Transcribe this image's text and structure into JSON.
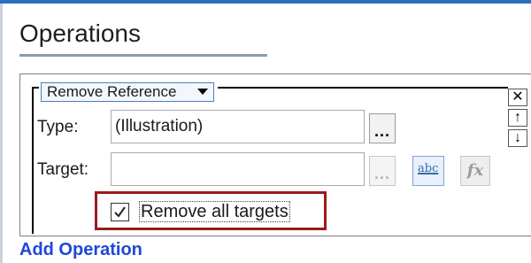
{
  "operations": {
    "title": "Operations",
    "operation_dropdown": {
      "value": "Remove Reference"
    },
    "type": {
      "label": "Type:",
      "value": "(Illustration)",
      "browse_label": "..."
    },
    "target": {
      "label": "Target:",
      "value": "",
      "browse_label": "...",
      "text_button_label": "abc",
      "formula_button_label": "fx"
    },
    "remove_all_targets": {
      "label": "Remove all targets",
      "checked": true
    },
    "side_controls": {
      "close_label": "✕",
      "move_up_label": "↑",
      "move_down_label": "↓"
    },
    "add_operation_label": "Add Operation"
  },
  "colors": {
    "accent_strip": "#2e6fbf",
    "highlight_border": "#9b1b1b",
    "link": "#1f47d8"
  }
}
